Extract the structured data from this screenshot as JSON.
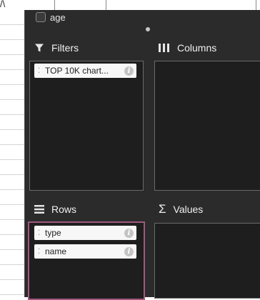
{
  "backdrop": {
    "top_text": "/\\"
  },
  "panel": {
    "top_field": {
      "label": "age"
    },
    "filters": {
      "title": "Filters",
      "items": [
        {
          "label": "TOP 10K chart..."
        }
      ]
    },
    "columns": {
      "title": "Columns",
      "items": []
    },
    "rows": {
      "title": "Rows",
      "items": [
        {
          "label": "type"
        },
        {
          "label": "name"
        }
      ]
    },
    "values": {
      "title": "Values",
      "items": []
    }
  },
  "colors": {
    "panel_bg": "#2b2b2b",
    "drop_zone_bg": "#1e1e1e",
    "active_zone_border": "#a0577e"
  }
}
